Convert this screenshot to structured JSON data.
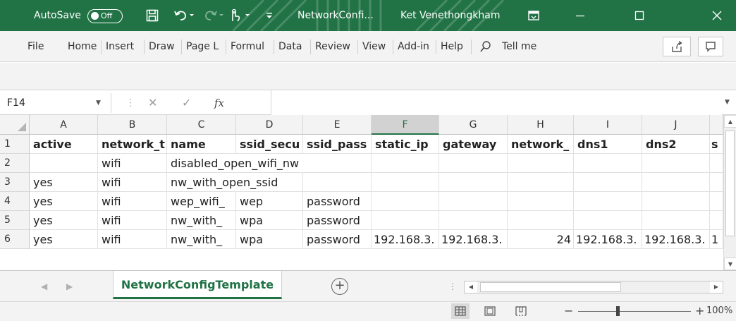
{
  "titlebar": {
    "autosave_label": "AutoSave",
    "autosave_state": "Off",
    "filename": "NetworkConfi...",
    "user": "Ket Venethongkham",
    "color": "#217346"
  },
  "ribbon": {
    "tabs": [
      "File",
      "Home",
      "Insert",
      "Draw",
      "Page L",
      "Formul",
      "Data",
      "Review",
      "View",
      "Add-in",
      "Help"
    ],
    "tell_me": "Tell me"
  },
  "formula_bar": {
    "name_box": "F14",
    "fx_label": "fx",
    "formula": ""
  },
  "grid": {
    "columns": [
      "A",
      "B",
      "C",
      "D",
      "E",
      "F",
      "G",
      "H",
      "I",
      "J"
    ],
    "selected_column": "F",
    "rows": [
      {
        "n": "1",
        "cells": [
          "active",
          "network_t",
          "name",
          "ssid_secu",
          "ssid_pass",
          "static_ip",
          "gateway",
          "network_",
          "dns1",
          "dns2",
          "s"
        ]
      },
      {
        "n": "2",
        "cells": [
          "",
          "wifi",
          "disabled_open_wifi_nw",
          "",
          "",
          "",
          "",
          "",
          "",
          "",
          ""
        ]
      },
      {
        "n": "3",
        "cells": [
          "yes",
          "wifi",
          "nw_with_open_ssid",
          "",
          "",
          "",
          "",
          "",
          "",
          "",
          ""
        ]
      },
      {
        "n": "4",
        "cells": [
          "yes",
          "wifi",
          "wep_wifi_",
          "wep",
          "password",
          "",
          "",
          "",
          "",
          "",
          ""
        ]
      },
      {
        "n": "5",
        "cells": [
          "yes",
          "wifi",
          "nw_with_",
          "wpa",
          "password",
          "",
          "",
          "",
          "",
          "",
          ""
        ]
      },
      {
        "n": "6",
        "cells": [
          "yes",
          "wifi",
          "nw_with_",
          "wpa",
          "password",
          "192.168.3.",
          "192.168.3.",
          "24",
          "192.168.3.",
          "192.168.3.",
          "1"
        ]
      }
    ]
  },
  "sheets": {
    "active_tab": "NetworkConfigTemplate"
  },
  "status": {
    "zoom": "100%",
    "zoom_level": 0.5
  }
}
